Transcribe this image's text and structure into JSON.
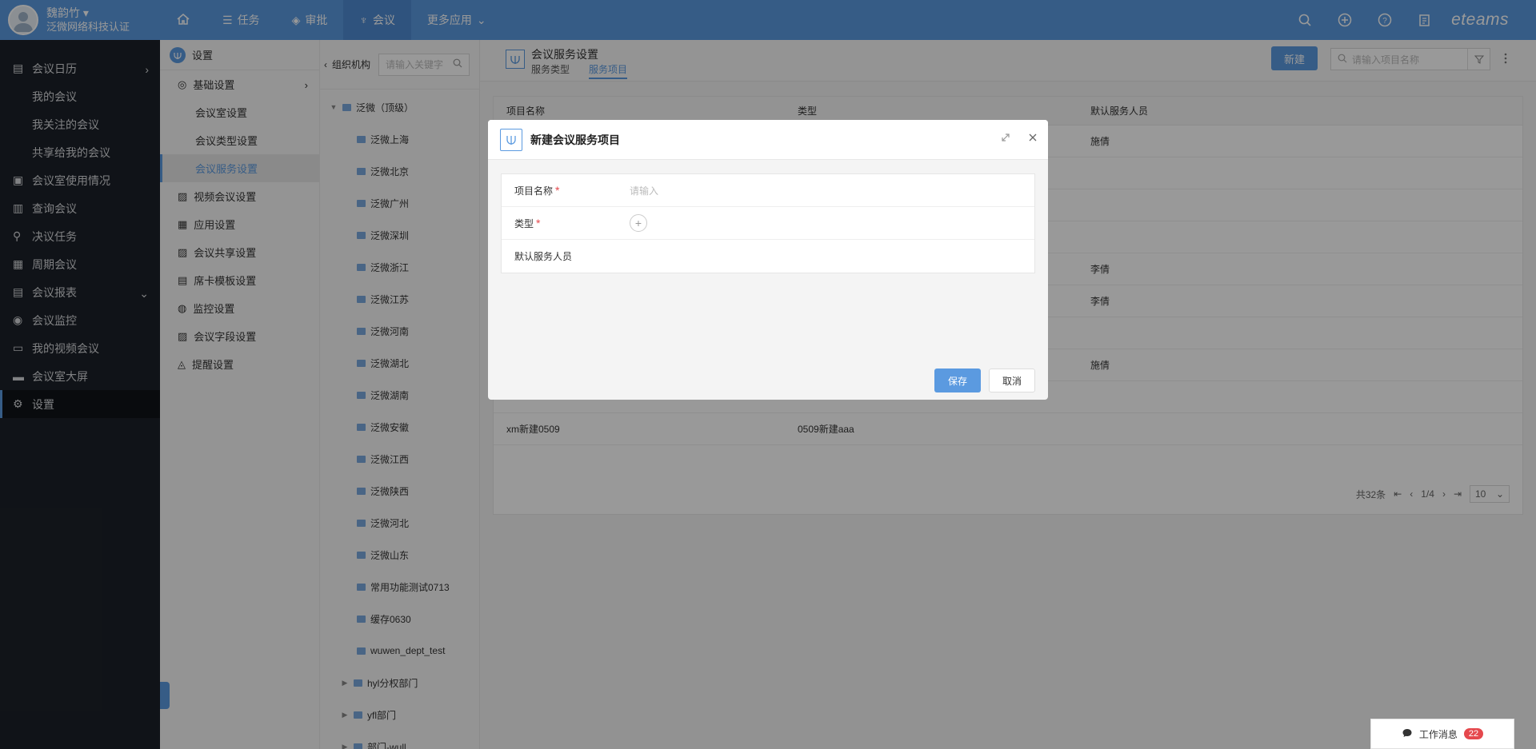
{
  "user": {
    "name": "魏韵竹",
    "company": "泛微网络科技认证"
  },
  "top_nav": [
    {
      "label": ""
    },
    {
      "label": "任务"
    },
    {
      "label": "审批"
    },
    {
      "label": "会议"
    },
    {
      "label": "更多应用"
    }
  ],
  "brand": "eteams",
  "sidebar": [
    {
      "label": "会议日历"
    },
    {
      "label": "我的会议"
    },
    {
      "label": "我关注的会议"
    },
    {
      "label": "共享给我的会议"
    },
    {
      "label": "会议室使用情况"
    },
    {
      "label": "查询会议"
    },
    {
      "label": "决议任务"
    },
    {
      "label": "周期会议"
    },
    {
      "label": "会议报表"
    },
    {
      "label": "会议监控"
    },
    {
      "label": "我的视频会议"
    },
    {
      "label": "会议室大屏"
    },
    {
      "label": "设置"
    }
  ],
  "settings": {
    "title": "设置",
    "items": [
      {
        "label": "基础设置"
      },
      {
        "label": "会议室设置"
      },
      {
        "label": "会议类型设置"
      },
      {
        "label": "会议服务设置"
      },
      {
        "label": "视频会议设置"
      },
      {
        "label": "应用设置"
      },
      {
        "label": "会议共享设置"
      },
      {
        "label": "席卡模板设置"
      },
      {
        "label": "监控设置"
      },
      {
        "label": "会议字段设置"
      },
      {
        "label": "提醒设置"
      }
    ]
  },
  "org": {
    "title": "组织机构",
    "search_placeholder": "请输入关键字",
    "tree": [
      {
        "label": "泛微（顶级）"
      },
      {
        "label": "泛微上海"
      },
      {
        "label": "泛微北京"
      },
      {
        "label": "泛微广州"
      },
      {
        "label": "泛微深圳"
      },
      {
        "label": "泛微浙江"
      },
      {
        "label": "泛微江苏"
      },
      {
        "label": "泛微河南"
      },
      {
        "label": "泛微湖北"
      },
      {
        "label": "泛微湖南"
      },
      {
        "label": "泛微安徽"
      },
      {
        "label": "泛微江西"
      },
      {
        "label": "泛微陕西"
      },
      {
        "label": "泛微河北"
      },
      {
        "label": "泛微山东"
      },
      {
        "label": "常用功能测试0713"
      },
      {
        "label": "缓存0630"
      },
      {
        "label": "wuwen_dept_test"
      },
      {
        "label": "hyl分权部门"
      },
      {
        "label": "yfl部门"
      },
      {
        "label": "部门-wull"
      }
    ]
  },
  "main": {
    "title": "会议服务设置",
    "tabs": [
      {
        "label": "服务类型"
      },
      {
        "label": "服务项目"
      }
    ],
    "new_button": "新建",
    "search_placeholder": "请输入项目名称",
    "columns": [
      "项目名称",
      "类型",
      "默认服务人员"
    ],
    "rows": [
      [
        "",
        "",
        "施倩"
      ],
      [
        "",
        "",
        ""
      ],
      [
        "",
        "",
        ""
      ],
      [
        "",
        "",
        ""
      ],
      [
        "",
        "",
        "李倩"
      ],
      [
        "",
        "",
        "李倩"
      ],
      [
        "",
        "",
        ""
      ],
      [
        "",
        "",
        "施倩"
      ],
      [
        "",
        "",
        ""
      ],
      [
        "xm新建0509",
        "0509新建aaa",
        ""
      ]
    ],
    "pagination": {
      "total": "共32条",
      "page": "1/4",
      "page_size": "10"
    }
  },
  "dialog": {
    "title": "新建会议服务项目",
    "fields": [
      {
        "label": "项目名称",
        "placeholder": "请输入"
      },
      {
        "label": "类型"
      },
      {
        "label": "默认服务人员"
      }
    ],
    "required_mark": "*",
    "save": "保存",
    "cancel": "取消"
  },
  "messages": {
    "label": "工作消息",
    "count": "22"
  },
  "colors": {
    "primary": "#5b9ae0",
    "sidebar_bg": "#1c2128",
    "required": "#e5484d"
  }
}
